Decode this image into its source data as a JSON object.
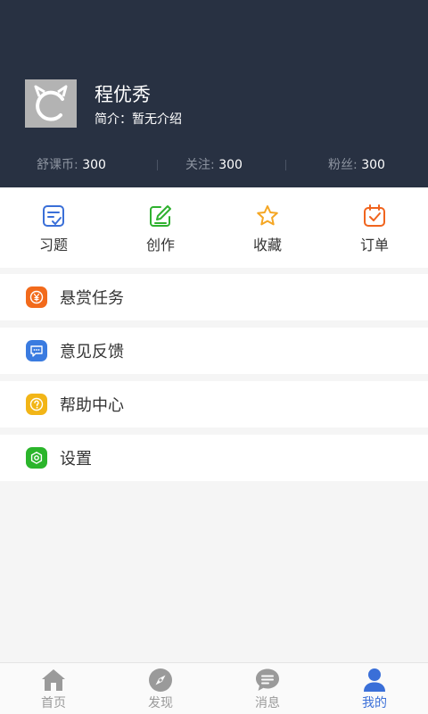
{
  "profile": {
    "name": "程优秀",
    "bio": "简介：暂无介绍",
    "stats": [
      {
        "key": "舒课币: ",
        "value": "300"
      },
      {
        "key": "关注: ",
        "value": "300"
      },
      {
        "key": "粉丝: ",
        "value": "300"
      }
    ]
  },
  "quick_actions": [
    {
      "label": "习题",
      "icon": "exercise-icon",
      "color": "#3a6fd8"
    },
    {
      "label": "创作",
      "icon": "edit-icon",
      "color": "#2fb12f"
    },
    {
      "label": "收藏",
      "icon": "star-icon",
      "color": "#f5a623"
    },
    {
      "label": "订单",
      "icon": "order-icon",
      "color": "#f0641e"
    }
  ],
  "menu": [
    {
      "label": "悬赏任务",
      "icon": "yen-icon",
      "color": "#f26a1b"
    },
    {
      "label": "意见反馈",
      "icon": "feedback-icon",
      "color": "#3a7be0"
    },
    {
      "label": "帮助中心",
      "icon": "help-icon",
      "color": "#f2b517"
    },
    {
      "label": "设置",
      "icon": "settings-icon",
      "color": "#2bb52b"
    }
  ],
  "tabs": [
    {
      "label": "首页",
      "icon": "home-icon"
    },
    {
      "label": "发现",
      "icon": "compass-icon"
    },
    {
      "label": "消息",
      "icon": "message-icon"
    },
    {
      "label": "我的",
      "icon": "user-icon",
      "active": true
    }
  ],
  "colors": {
    "header_bg": "#283142",
    "active_tab": "#3a6fd8",
    "inactive_tab": "#9a9a9a"
  }
}
